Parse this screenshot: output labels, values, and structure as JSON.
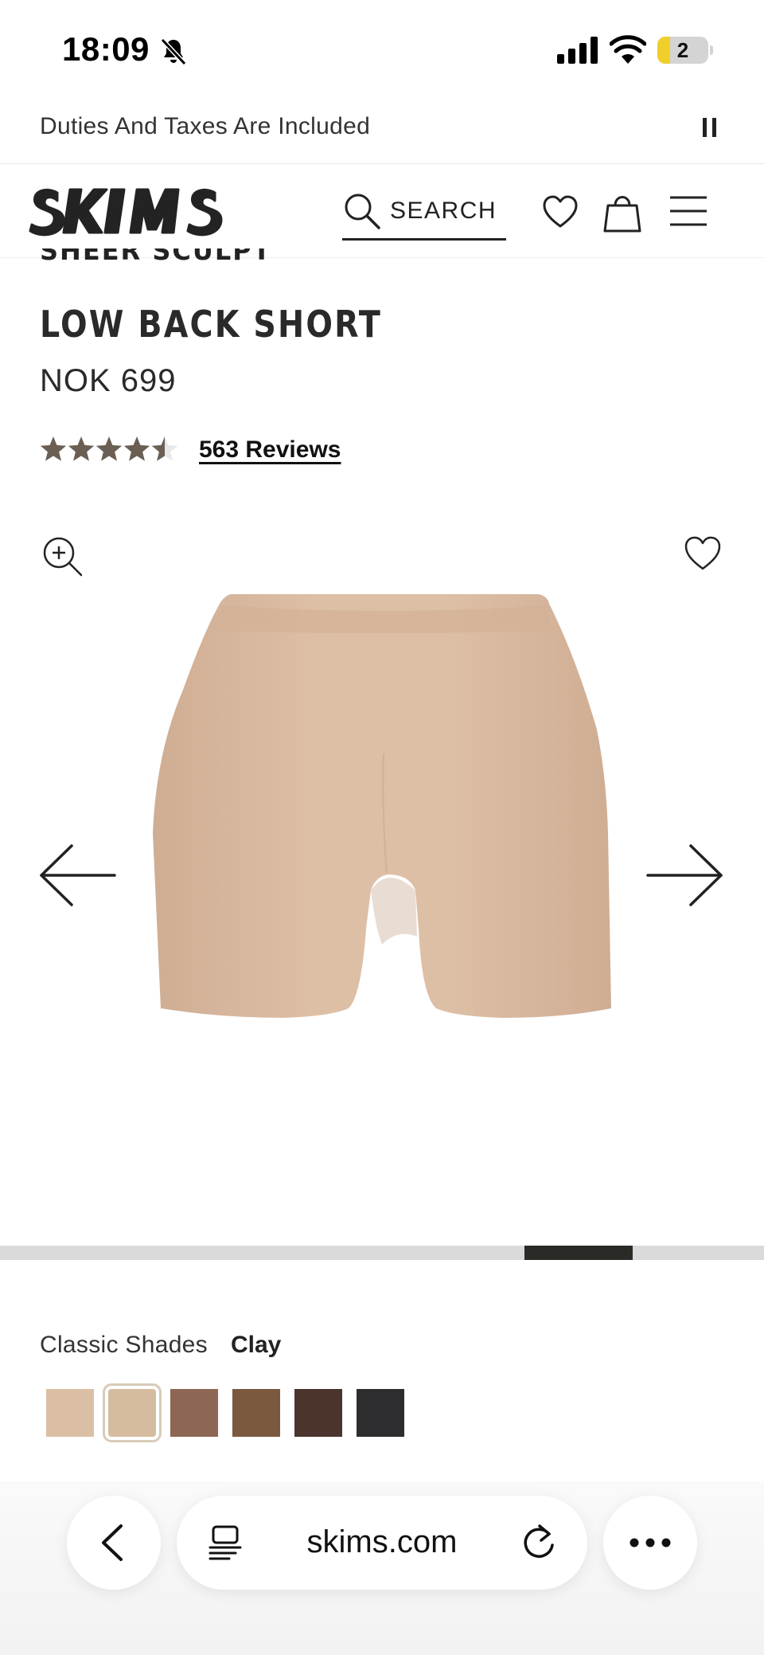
{
  "status_bar": {
    "time": "18:09",
    "battery_level": "2",
    "battery_fraction": 0.25,
    "icons": [
      "bell-slash-icon",
      "cellular-signal-icon",
      "wifi-icon",
      "battery-icon"
    ]
  },
  "announcement": {
    "text": "Duties And Taxes Are Included",
    "control_icon": "pause-icon"
  },
  "header": {
    "logo_text": "SKIMS",
    "search_label": "SEARCH",
    "icons": [
      "search-icon",
      "heart-icon",
      "shopping-bag-icon",
      "hamburger-menu-icon"
    ]
  },
  "product": {
    "collection": "SHEER SCULPT",
    "title": "LOW BACK SHORT",
    "price": "NOK 699",
    "rating": 4.5,
    "rating_max": 5,
    "reviews_label": "563 Reviews"
  },
  "gallery": {
    "icons": [
      "zoom-in-icon",
      "heart-icon",
      "arrow-left-icon",
      "arrow-right-icon"
    ],
    "image_subject": "nude-toned shaping shorts",
    "carousel_position": 0.8
  },
  "shades": {
    "group_label": "Classic Shades",
    "selected_name": "Clay",
    "swatches": [
      {
        "name": "shade-1",
        "color": "#dbbfa5"
      },
      {
        "name": "Clay",
        "color": "#d5bc9f",
        "selected": true
      },
      {
        "name": "shade-3",
        "color": "#8d6655"
      },
      {
        "name": "shade-4",
        "color": "#7a593e"
      },
      {
        "name": "shade-5",
        "color": "#4a342c"
      },
      {
        "name": "shade-6",
        "color": "#2d2d2f"
      }
    ]
  },
  "browser": {
    "url": "skims.com",
    "icons": [
      "chevron-left-icon",
      "tabs-icon",
      "reload-icon",
      "more-icon"
    ]
  },
  "colors": {
    "accent_dark": "#2a2a27",
    "star": "#6b5e53",
    "product_fabric": "#d9b9a0"
  }
}
